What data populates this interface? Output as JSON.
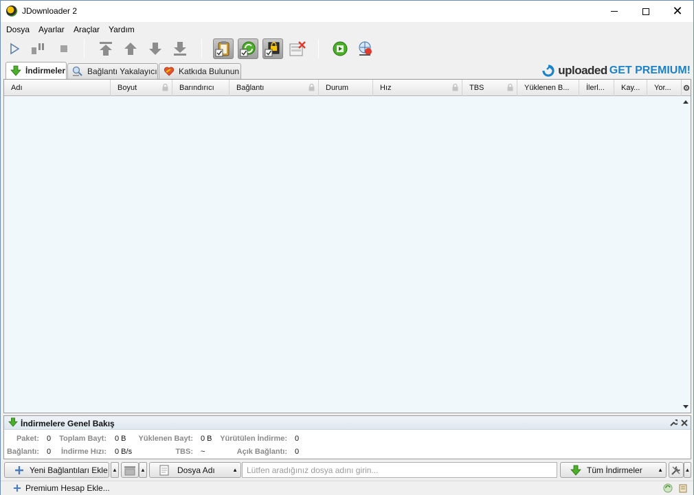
{
  "window": {
    "title": "JDownloader 2"
  },
  "menu": [
    "Dosya",
    "Ayarlar",
    "Araçlar",
    "Yardım"
  ],
  "toolbar": {
    "icons": [
      "play-icon",
      "pause-icon",
      "stop-icon",
      "move-top-icon",
      "move-up-icon",
      "move-down-icon",
      "move-bottom-icon",
      "clipboard-observer-icon",
      "auto-reconnect-icon",
      "premium-toggle-icon",
      "clean-up-icon",
      "update-icon",
      "reconnect-icon"
    ]
  },
  "tabs": [
    {
      "label": "İndirmeler",
      "icon": "download-arrow-icon",
      "active": true
    },
    {
      "label": "Bağlantı Yakalayıcı",
      "icon": "linkgrabber-icon",
      "active": false
    },
    {
      "label": "Katkıda Bulunun",
      "icon": "heart-icon",
      "active": false
    }
  ],
  "premium_banner": {
    "brand": "uploaded",
    "cta": "GET PREMIUM!"
  },
  "table": {
    "columns": [
      "Adı",
      "Boyut",
      "Barındırıcı",
      "Bağlantı",
      "Durum",
      "Hız",
      "TBS",
      "Yüklenen B...",
      "İlerl...",
      "Kay...",
      "Yor..."
    ],
    "rows": []
  },
  "overview": {
    "title": "İndirmelere Genel Bakış",
    "row1": [
      {
        "label": "Paket:",
        "value": "0"
      },
      {
        "label": "Toplam Bayt:",
        "value": "0 B"
      },
      {
        "label": "Yüklenen Bayt:",
        "value": "0 B"
      },
      {
        "label": "Yürütülen İndirme:",
        "value": "0"
      }
    ],
    "row2": [
      {
        "label": "Bağlantı:",
        "value": "0"
      },
      {
        "label": "İndirme Hızı:",
        "value": "0 B/s"
      },
      {
        "label": "TBS:",
        "value": "~"
      },
      {
        "label": "Açık Bağlantı:",
        "value": "0"
      }
    ]
  },
  "bottom": {
    "add_links": "Yeni Bağlantıları Ekle",
    "search_field": "Dosya Adı",
    "search_placeholder": "Lütfen aradığınız dosya adını girin...",
    "view_select": "Tüm İndirmeler"
  },
  "status": {
    "premium_account": "Premium Hesap Ekle..."
  },
  "colors": {
    "accent": "#1c82c8",
    "table_bg": "#f1f8fc",
    "download_green": "#4caf2a"
  }
}
